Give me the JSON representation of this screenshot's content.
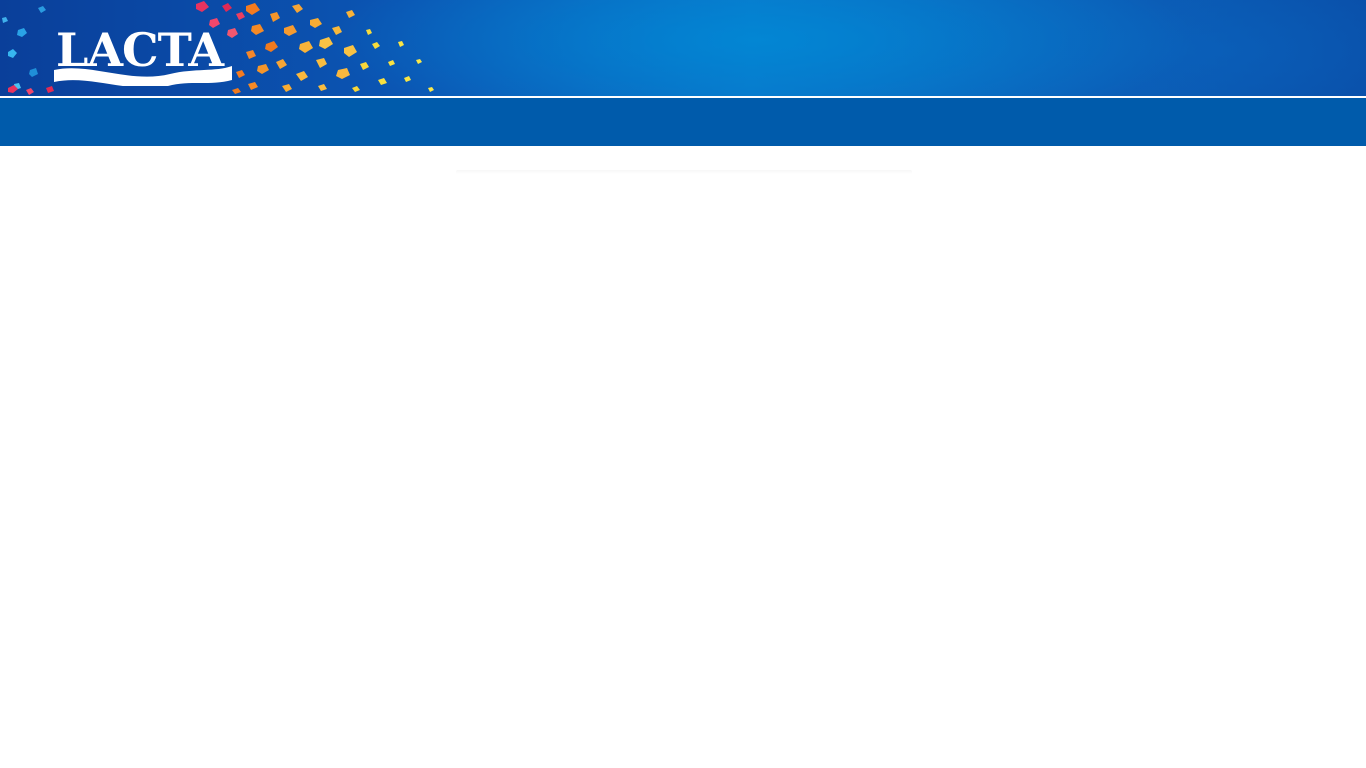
{
  "brand": {
    "logo_text": "LACTA",
    "logo_color": "#ffffff"
  },
  "colors": {
    "nav_bar": "#005bab",
    "banner_primary": "#0b56b4",
    "banner_light": "#0a74c9",
    "background": "#ffffff"
  },
  "icons": {
    "logo": "lacta-logo",
    "decoration": "confetti-pieces"
  }
}
